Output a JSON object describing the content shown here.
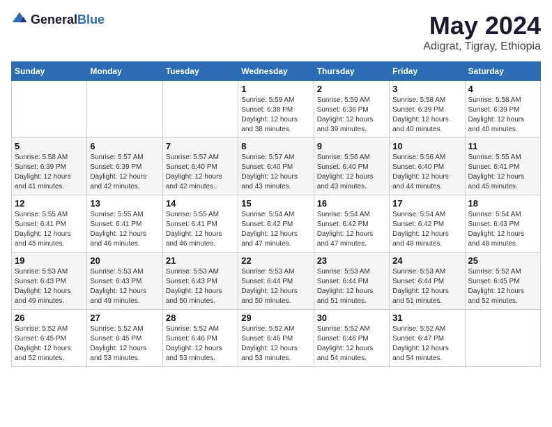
{
  "header": {
    "logo": {
      "general": "General",
      "blue": "Blue"
    },
    "month": "May 2024",
    "location": "Adigrat, Tigray, Ethiopia"
  },
  "weekdays": [
    "Sunday",
    "Monday",
    "Tuesday",
    "Wednesday",
    "Thursday",
    "Friday",
    "Saturday"
  ],
  "weeks": [
    [
      {
        "day": "",
        "info": ""
      },
      {
        "day": "",
        "info": ""
      },
      {
        "day": "",
        "info": ""
      },
      {
        "day": "1",
        "info": "Sunrise: 5:59 AM\nSunset: 6:38 PM\nDaylight: 12 hours\nand 38 minutes."
      },
      {
        "day": "2",
        "info": "Sunrise: 5:59 AM\nSunset: 6:38 PM\nDaylight: 12 hours\nand 39 minutes."
      },
      {
        "day": "3",
        "info": "Sunrise: 5:58 AM\nSunset: 6:39 PM\nDaylight: 12 hours\nand 40 minutes."
      },
      {
        "day": "4",
        "info": "Sunrise: 5:58 AM\nSunset: 6:39 PM\nDaylight: 12 hours\nand 40 minutes."
      }
    ],
    [
      {
        "day": "5",
        "info": "Sunrise: 5:58 AM\nSunset: 6:39 PM\nDaylight: 12 hours\nand 41 minutes."
      },
      {
        "day": "6",
        "info": "Sunrise: 5:57 AM\nSunset: 6:39 PM\nDaylight: 12 hours\nand 42 minutes."
      },
      {
        "day": "7",
        "info": "Sunrise: 5:57 AM\nSunset: 6:40 PM\nDaylight: 12 hours\nand 42 minutes."
      },
      {
        "day": "8",
        "info": "Sunrise: 5:57 AM\nSunset: 6:40 PM\nDaylight: 12 hours\nand 43 minutes."
      },
      {
        "day": "9",
        "info": "Sunrise: 5:56 AM\nSunset: 6:40 PM\nDaylight: 12 hours\nand 43 minutes."
      },
      {
        "day": "10",
        "info": "Sunrise: 5:56 AM\nSunset: 6:40 PM\nDaylight: 12 hours\nand 44 minutes."
      },
      {
        "day": "11",
        "info": "Sunrise: 5:55 AM\nSunset: 6:41 PM\nDaylight: 12 hours\nand 45 minutes."
      }
    ],
    [
      {
        "day": "12",
        "info": "Sunrise: 5:55 AM\nSunset: 6:41 PM\nDaylight: 12 hours\nand 45 minutes."
      },
      {
        "day": "13",
        "info": "Sunrise: 5:55 AM\nSunset: 6:41 PM\nDaylight: 12 hours\nand 46 minutes."
      },
      {
        "day": "14",
        "info": "Sunrise: 5:55 AM\nSunset: 6:41 PM\nDaylight: 12 hours\nand 46 minutes."
      },
      {
        "day": "15",
        "info": "Sunrise: 5:54 AM\nSunset: 6:42 PM\nDaylight: 12 hours\nand 47 minutes."
      },
      {
        "day": "16",
        "info": "Sunrise: 5:54 AM\nSunset: 6:42 PM\nDaylight: 12 hours\nand 47 minutes."
      },
      {
        "day": "17",
        "info": "Sunrise: 5:54 AM\nSunset: 6:42 PM\nDaylight: 12 hours\nand 48 minutes."
      },
      {
        "day": "18",
        "info": "Sunrise: 5:54 AM\nSunset: 6:43 PM\nDaylight: 12 hours\nand 48 minutes."
      }
    ],
    [
      {
        "day": "19",
        "info": "Sunrise: 5:53 AM\nSunset: 6:43 PM\nDaylight: 12 hours\nand 49 minutes."
      },
      {
        "day": "20",
        "info": "Sunrise: 5:53 AM\nSunset: 6:43 PM\nDaylight: 12 hours\nand 49 minutes."
      },
      {
        "day": "21",
        "info": "Sunrise: 5:53 AM\nSunset: 6:43 PM\nDaylight: 12 hours\nand 50 minutes."
      },
      {
        "day": "22",
        "info": "Sunrise: 5:53 AM\nSunset: 6:44 PM\nDaylight: 12 hours\nand 50 minutes."
      },
      {
        "day": "23",
        "info": "Sunrise: 5:53 AM\nSunset: 6:44 PM\nDaylight: 12 hours\nand 51 minutes."
      },
      {
        "day": "24",
        "info": "Sunrise: 5:53 AM\nSunset: 6:44 PM\nDaylight: 12 hours\nand 51 minutes."
      },
      {
        "day": "25",
        "info": "Sunrise: 5:52 AM\nSunset: 6:45 PM\nDaylight: 12 hours\nand 52 minutes."
      }
    ],
    [
      {
        "day": "26",
        "info": "Sunrise: 5:52 AM\nSunset: 6:45 PM\nDaylight: 12 hours\nand 52 minutes."
      },
      {
        "day": "27",
        "info": "Sunrise: 5:52 AM\nSunset: 6:45 PM\nDaylight: 12 hours\nand 53 minutes."
      },
      {
        "day": "28",
        "info": "Sunrise: 5:52 AM\nSunset: 6:46 PM\nDaylight: 12 hours\nand 53 minutes."
      },
      {
        "day": "29",
        "info": "Sunrise: 5:52 AM\nSunset: 6:46 PM\nDaylight: 12 hours\nand 53 minutes."
      },
      {
        "day": "30",
        "info": "Sunrise: 5:52 AM\nSunset: 6:46 PM\nDaylight: 12 hours\nand 54 minutes."
      },
      {
        "day": "31",
        "info": "Sunrise: 5:52 AM\nSunset: 6:47 PM\nDaylight: 12 hours\nand 54 minutes."
      },
      {
        "day": "",
        "info": ""
      }
    ]
  ]
}
